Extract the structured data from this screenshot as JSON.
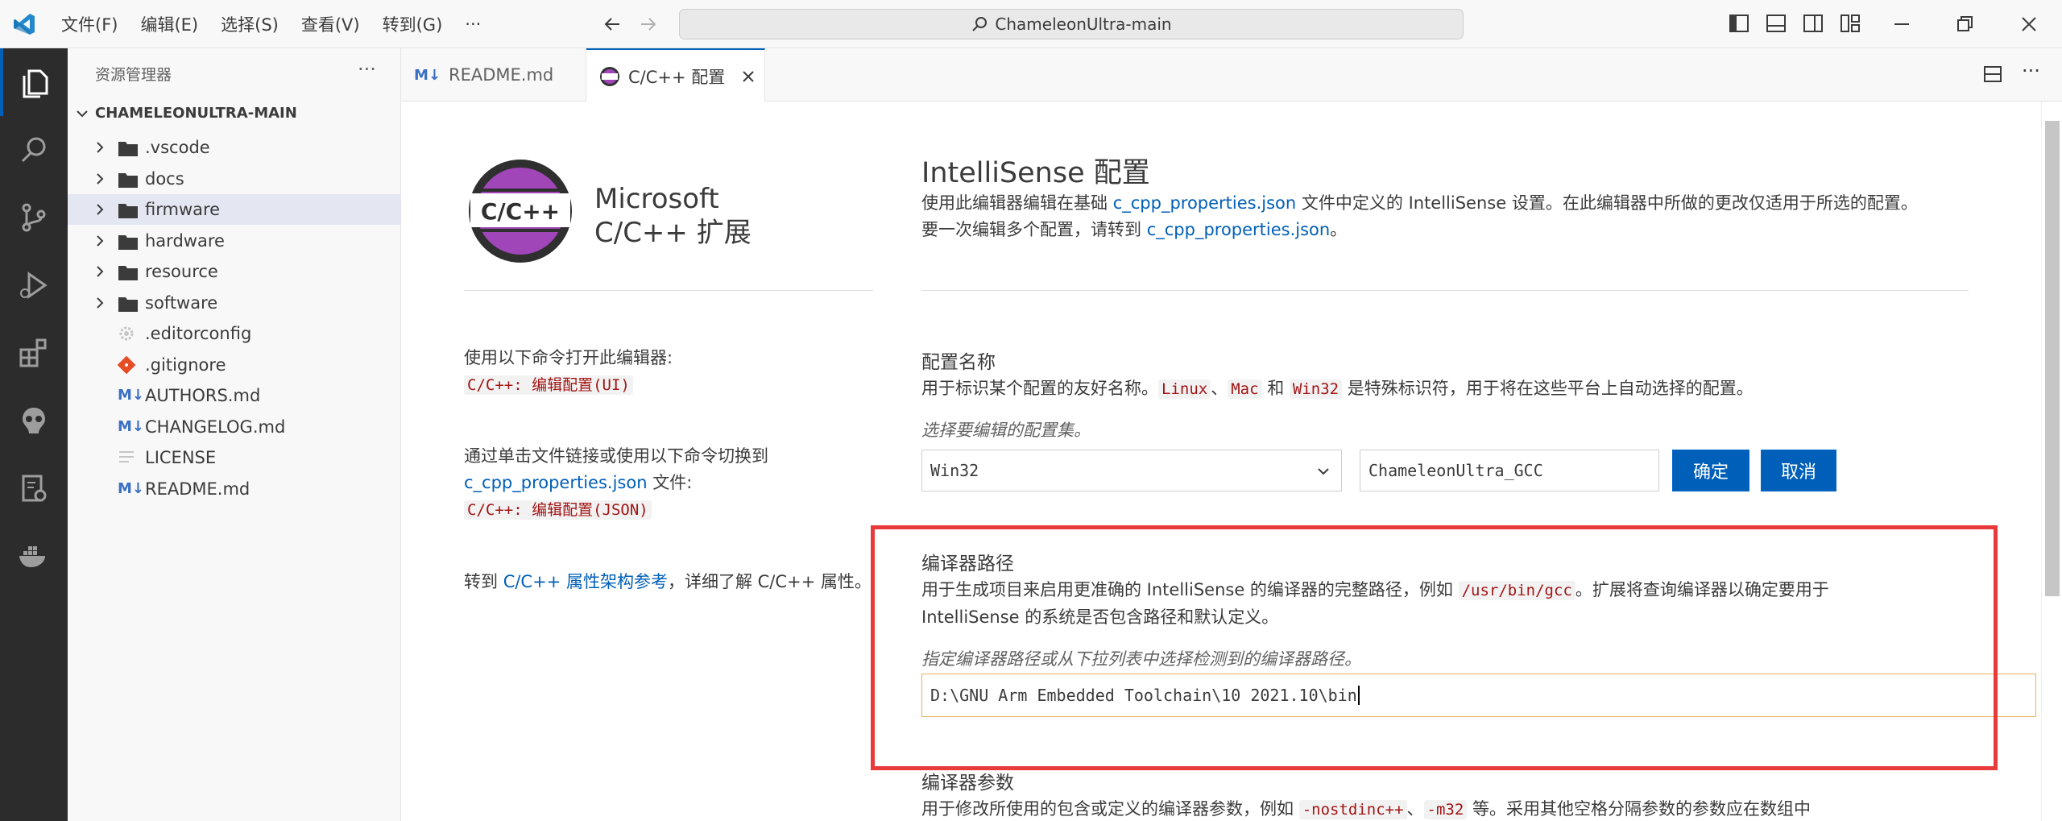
{
  "titlebar": {
    "menu": [
      "文件(F)",
      "编辑(E)",
      "选择(S)",
      "查看(V)",
      "转到(G)",
      "···"
    ],
    "search": "ChameleonUltra-main"
  },
  "sidebar": {
    "title": "资源管理器",
    "more": "···",
    "root": "CHAMELEONULTRA-MAIN",
    "items": [
      {
        "label": ".vscode",
        "type": "folder",
        "icon": "folder-icon"
      },
      {
        "label": "docs",
        "type": "folder",
        "icon": "folder-icon"
      },
      {
        "label": "firmware",
        "type": "folder",
        "icon": "folder-icon"
      },
      {
        "label": "hardware",
        "type": "folder",
        "icon": "folder-icon"
      },
      {
        "label": "resource",
        "type": "folder",
        "icon": "folder-icon"
      },
      {
        "label": "software",
        "type": "folder",
        "icon": "folder-icon"
      },
      {
        "label": ".editorconfig",
        "type": "file",
        "icon": "gear-file-icon"
      },
      {
        "label": ".gitignore",
        "type": "file",
        "icon": "git-file-icon"
      },
      {
        "label": "AUTHORS.md",
        "type": "file",
        "icon": "markdown-icon"
      },
      {
        "label": "CHANGELOG.md",
        "type": "file",
        "icon": "markdown-icon"
      },
      {
        "label": "LICENSE",
        "type": "file",
        "icon": "text-file-icon"
      },
      {
        "label": "README.md",
        "type": "file",
        "icon": "markdown-icon"
      }
    ]
  },
  "tabs": [
    {
      "label": "README.md",
      "active": false
    },
    {
      "label": "C/C++ 配置",
      "active": true
    }
  ],
  "editor": {
    "product_line1": "Microsoft",
    "product_line2": "C/C++ 扩展",
    "logo_text": "C/C++",
    "left1_text": "使用以下命令打开此编辑器:",
    "left1_code": "C/C++: 编辑配置(UI)",
    "left2_text": "通过单击文件链接或使用以下命令切换到",
    "left2_link": "c_cpp_properties.json",
    "left2_suffix": " 文件:",
    "left2_code": "C/C++: 编辑配置(JSON)",
    "left3_prefix": "转到 ",
    "left3_link": "C/C++ 属性架构参考",
    "left3_suffix": "，详细了解 C/C++ 属性。",
    "title": "IntelliSense 配置",
    "desc_a": "使用此编辑器编辑在基础 ",
    "desc_link1": "c_cpp_properties.json",
    "desc_b": " 文件中定义的 IntelliSense 设置。在此编辑器中所做的更改仅适用于所选的配置。",
    "desc_c": "要一次编辑多个配置，请转到 ",
    "desc_link2": "c_cpp_properties.json",
    "desc_d": "。",
    "config_name": {
      "heading": "配置名称",
      "desc_a": "用于标识某个配置的友好名称。",
      "code1": "Linux",
      "sep1": "、",
      "code2": "Mac",
      "sep2": " 和 ",
      "code3": "Win32",
      "desc_b": " 是特殊标识符，用于将在这些平台上自动选择的配置。",
      "hint": "选择要编辑的配置集。",
      "select_value": "Win32",
      "input_value": "ChameleonUltra_GCC",
      "ok": "确定",
      "cancel": "取消"
    },
    "compiler_path": {
      "heading": "编译器路径",
      "desc_a": "用于生成项目来启用更准确的 IntelliSense 的编译器的完整路径，例如 ",
      "code": "/usr/bin/gcc",
      "desc_b": "。扩展将查询编译器以确定要用于",
      "desc_c": "IntelliSense 的系统是否包含路径和默认定义。",
      "hint": "指定编译器路径或从下拉列表中选择检测到的编译器路径。",
      "value": "D:\\GNU Arm Embedded Toolchain\\10 2021.10\\bin"
    },
    "compiler_args": {
      "heading": "编译器参数",
      "desc_a": "用于修改所使用的包含或定义的编译器参数，例如 ",
      "code1": "-nostdinc++",
      "sep": "、",
      "code2": "-m32",
      "desc_b": " 等。采用其他空格分隔参数的参数应在数组中"
    }
  },
  "colors": {
    "accent": "#005fb8",
    "highlight_box": "#e8393b",
    "activity_bar": "#2c2c2c",
    "logo_purple": "#a046b8"
  }
}
